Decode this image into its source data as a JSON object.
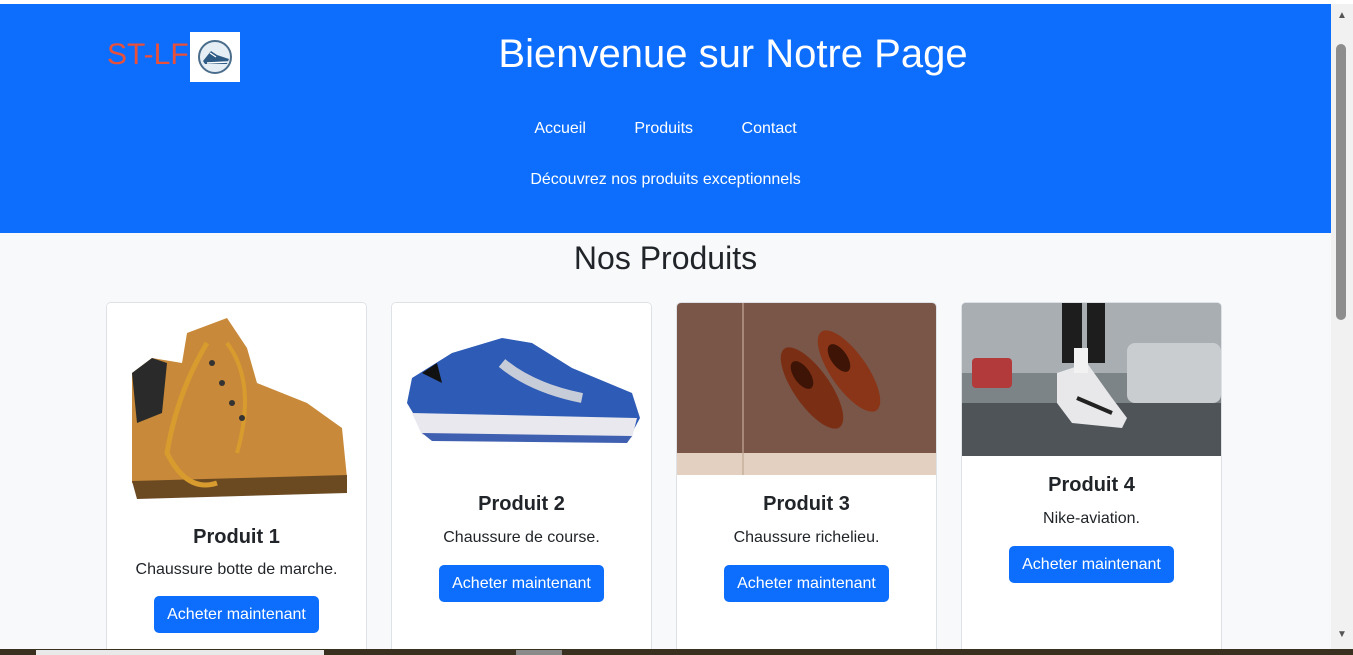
{
  "header": {
    "logo_text": "ST-LF",
    "title": "Bienvenue sur Notre Page",
    "nav": [
      "Accueil",
      "Produits",
      "Contact"
    ],
    "tagline": "Découvrez nos produits exceptionnels"
  },
  "products_section": {
    "title": "Nos Produits",
    "button_label": "Acheter maintenant",
    "products": [
      {
        "name": "Produit 1",
        "description": "Chaussure botte de marche."
      },
      {
        "name": "Produit 2",
        "description": "Chaussure de course."
      },
      {
        "name": "Produit 3",
        "description": "Chaussure richelieu."
      },
      {
        "name": "Produit 4",
        "description": "Nike-aviation."
      }
    ]
  },
  "colors": {
    "header_bg": "#0d6efd",
    "logo_text": "#e8503a",
    "button_bg": "#0d6efd",
    "page_bg": "#f8f9fa"
  }
}
